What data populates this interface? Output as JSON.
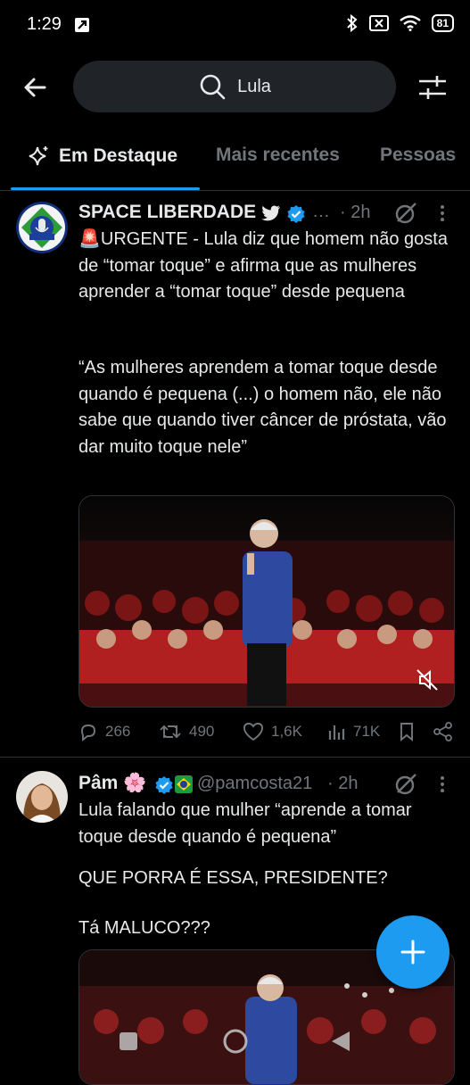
{
  "status": {
    "time": "1:29",
    "battery": "81"
  },
  "search": {
    "query": "Lula"
  },
  "tabs": {
    "featured": "Em Destaque",
    "latest": "Mais recentes",
    "people": "Pessoas"
  },
  "tweets": [
    {
      "name": "SPACE LIBERDADE",
      "more": "…",
      "time": "· 2h",
      "paragraphs": [
        "🚨URGENTE - Lula diz que homem não gosta de “tomar toque” e afirma que as mulheres aprender a “tomar toque” desde pequena",
        "“As mulheres aprendem a tomar toque desde quando é pequena (...) o homem não, ele não sabe que quando tiver câncer de próstata, vão dar muito toque nele”"
      ],
      "replies": "266",
      "retweets": "490",
      "likes": "1,6K",
      "views": "71K"
    },
    {
      "name": "Pâm 🌸",
      "handle": "@pamcosta21",
      "time": "· 2h",
      "paragraphs": [
        "Lula falando que mulher “aprende a tomar toque desde quando é pequena”",
        "QUE PORRA É ESSA, PRESIDENTE?",
        "Tá MALUCO???"
      ]
    }
  ],
  "colors": {
    "accent": "#1d9bf0",
    "background": "#000000",
    "muted": "#71767b",
    "border": "#2f3336"
  }
}
